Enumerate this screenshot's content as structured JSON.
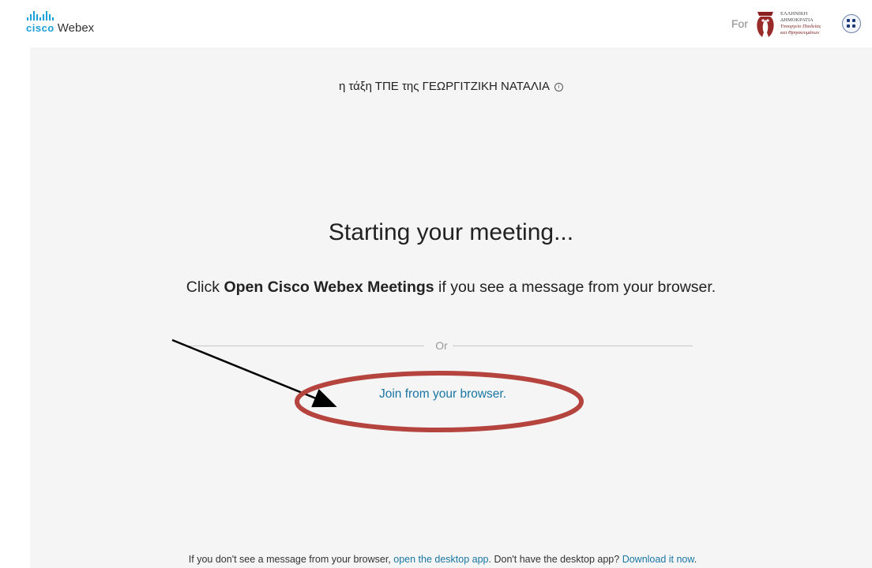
{
  "header": {
    "brand_cisco": "cisco",
    "brand_webex": "Webex",
    "for_label": "For",
    "org_line1": "ΕΛΛΗΝΙΚΗ ΔΗΜΟΚΡΑΤΙΑ",
    "org_line2": "Υπουργείο Παιδείας",
    "org_line3": "και Θρησκευμάτων"
  },
  "meeting": {
    "title": "η τάξη ΤΠΕ της ΓΕΩΡΓΙΤΖΙΚΗ ΝΑΤΑΛΙΑ"
  },
  "main": {
    "heading": "Starting your meeting...",
    "instruction_prefix": "Click ",
    "instruction_bold": "Open Cisco Webex Meetings",
    "instruction_suffix": " if you see a message from your browser.",
    "or_text": "Or",
    "join_link": "Join from your browser."
  },
  "footer": {
    "text1": "If you don't see a message from your browser, ",
    "link1": "open the desktop app",
    "text2": ". Don't have the desktop app? ",
    "link2": "Download it now",
    "text3": "."
  },
  "colors": {
    "accent": "#1976a3",
    "brand": "#1ba0d7",
    "annotation": "#b5443f",
    "background": "#f5f5f5"
  },
  "icons": [
    "cisco-logo-icon",
    "org-emblem-icon",
    "globe-icon",
    "info-icon"
  ]
}
